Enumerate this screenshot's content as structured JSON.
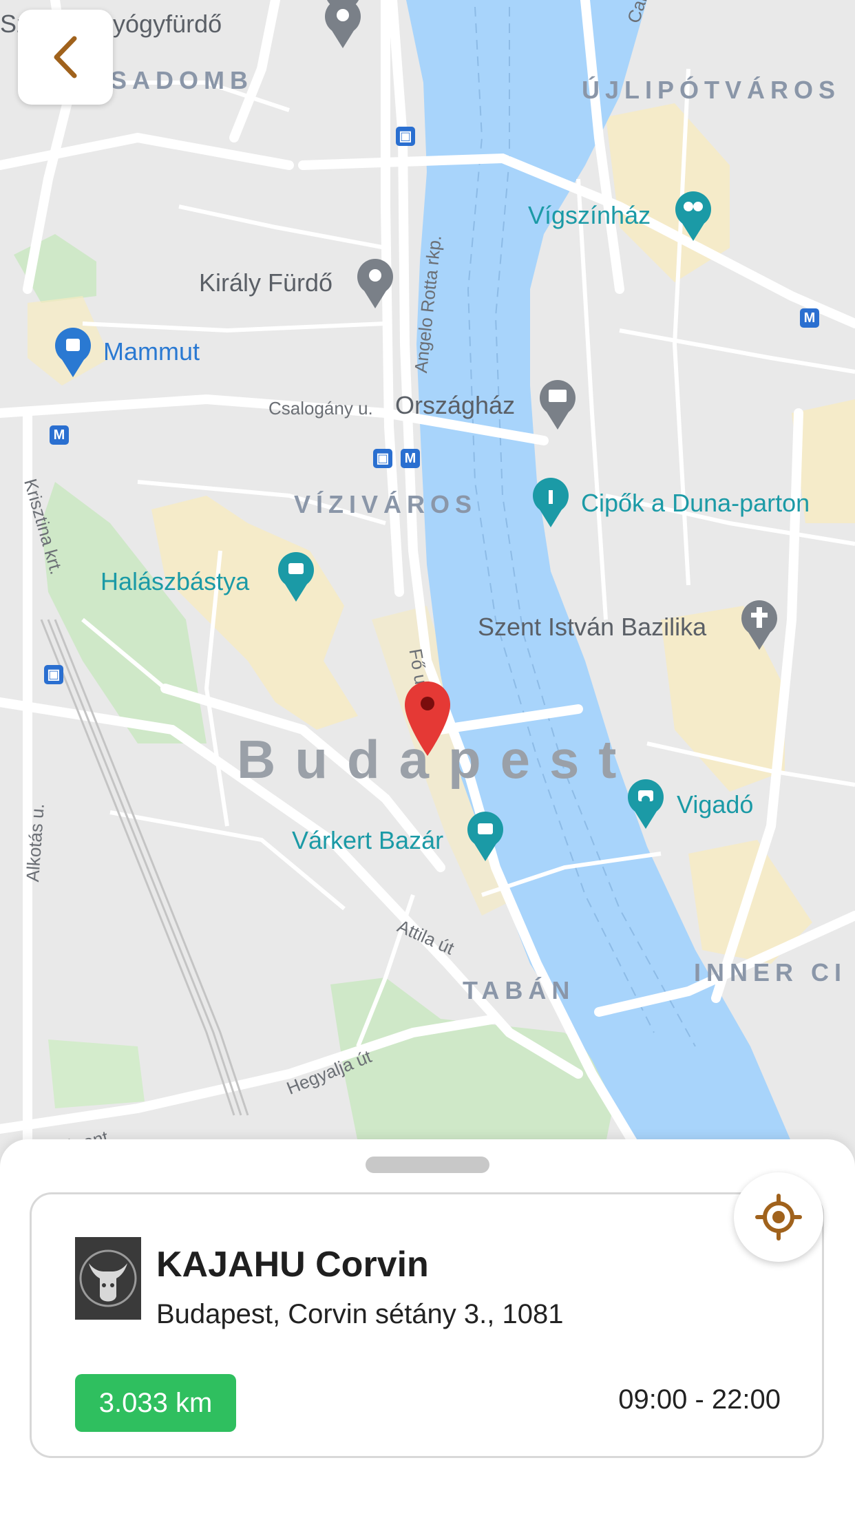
{
  "map": {
    "city_label": "Budapest",
    "districts": {
      "rozsadomb": "SADOMB",
      "ujlipotvaros": "ÚJLIPÓTVÁROS",
      "viziváros": "VÍZIVÁROS",
      "taban": "TABÁN",
      "inner_city": "INNER CI"
    },
    "pois": {
      "lukacs": "Sz  kács Gyógyfürdő",
      "vigszinhaz": "Vígszínház",
      "kiraly_furdo": "Király Fürdő",
      "mammut": "Mammut",
      "orszaghaz": "Országház",
      "cipok": "Cipők a Duna-parton",
      "halaszbastya": "Halászbástya",
      "szent_istvan": "Szent István Bazilika",
      "vigado": "Vigadó",
      "varkert": "Várkert Bazár"
    },
    "streets": {
      "carl": "Carl L",
      "angelo_rotta": "Angelo Rotta rkp.",
      "csalogany": "Csalogány u.",
      "krisztina": "Krisztina krt.",
      "fo_u": "Fő u.",
      "alkotas": "Alkotás u.",
      "attila": "Attila út",
      "hegyalja": "Hegyalja út",
      "moricz": "ámópont"
    },
    "transit": {
      "metro": "M",
      "train": "▣"
    }
  },
  "location": {
    "name": "KAJAHU Corvin",
    "address": "Budapest, Corvin sétány 3., 1081",
    "distance": "3.033 km",
    "hours": "09:00 - 22:00"
  },
  "icons": {
    "back": "chevron-left-icon",
    "locate": "crosshair-icon",
    "pin": "map-pin-icon",
    "logo": "restaurant-logo"
  },
  "colors": {
    "accent": "#a0621c",
    "distance_badge": "#2fbf5f",
    "pin": "#e53935",
    "river": "#a8d4fb"
  }
}
